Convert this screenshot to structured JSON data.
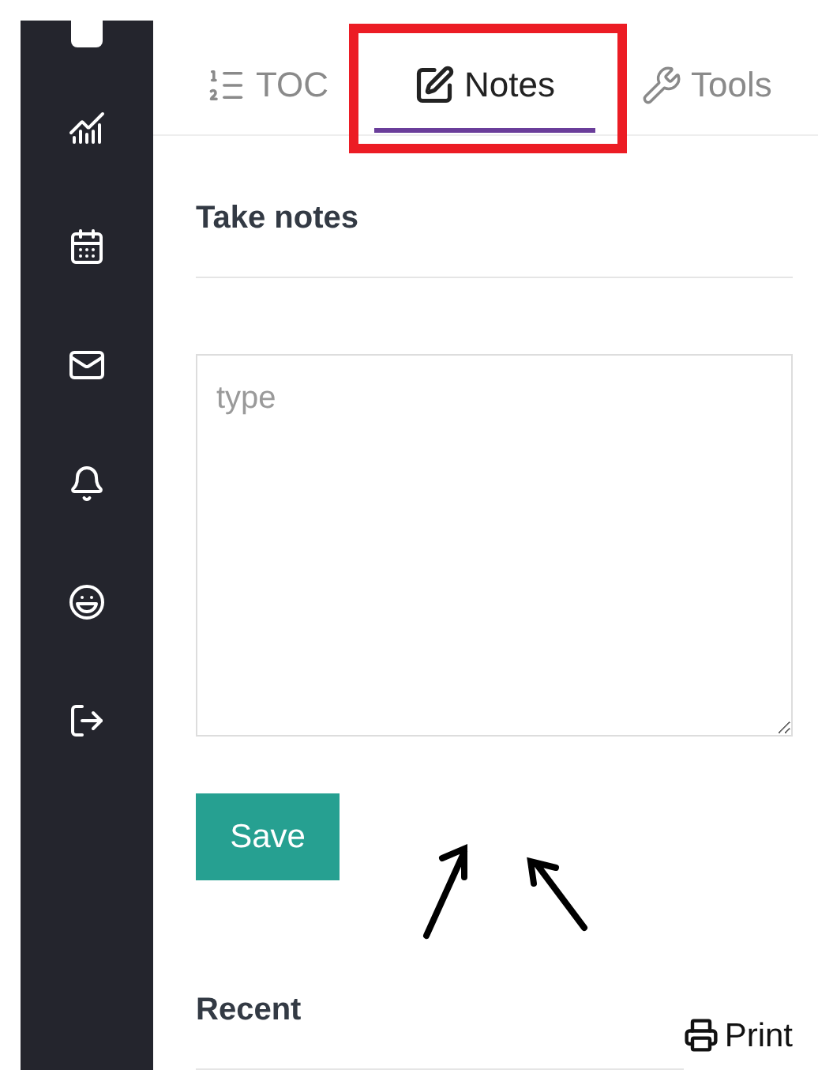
{
  "sidebar": {
    "items": [
      {
        "kind": "page"
      },
      {
        "kind": "chart"
      },
      {
        "kind": "calendar"
      },
      {
        "kind": "mail"
      },
      {
        "kind": "bell"
      },
      {
        "kind": "smile"
      },
      {
        "kind": "logout"
      }
    ]
  },
  "tabs": [
    {
      "label": "TOC",
      "kind": "toc",
      "selected": false
    },
    {
      "label": "Notes",
      "kind": "notes",
      "selected": true
    },
    {
      "label": "Tools",
      "kind": "tools",
      "selected": false
    }
  ],
  "notes": {
    "title": "Take notes",
    "placeholder": "type",
    "save": "Save"
  },
  "recent": {
    "title": "Recent",
    "print": "Print"
  }
}
